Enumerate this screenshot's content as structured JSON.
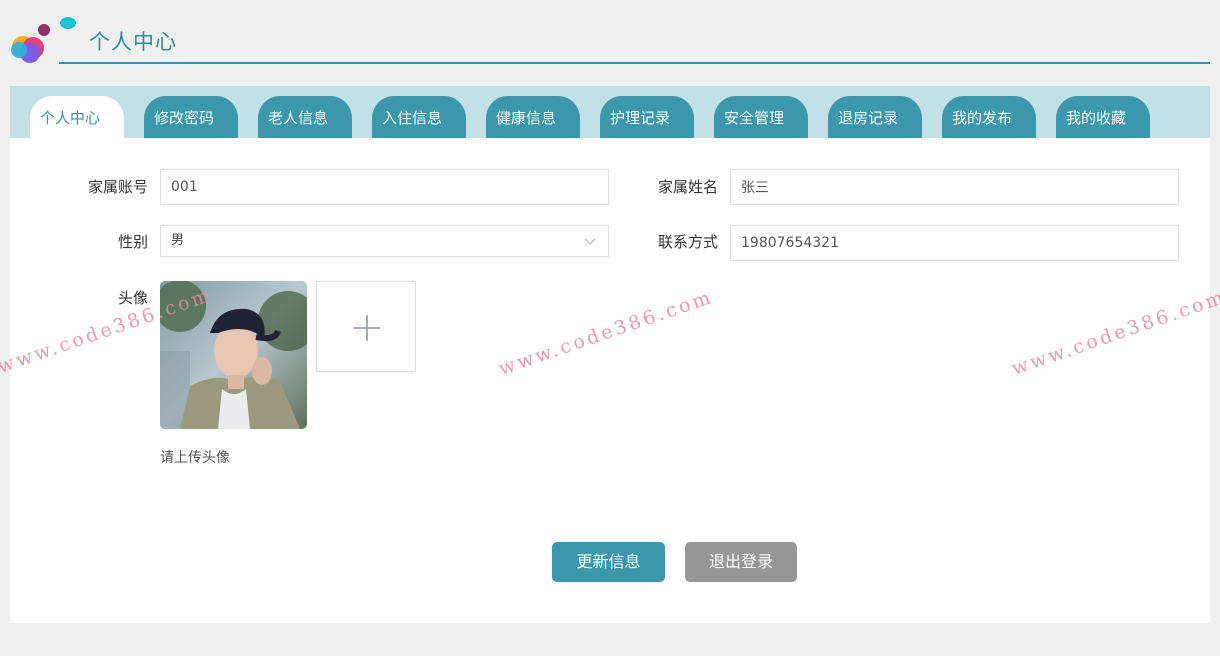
{
  "header": {
    "title": "个人中心"
  },
  "tabs": [
    {
      "label": "个人中心",
      "active": true
    },
    {
      "label": "修改密码",
      "active": false
    },
    {
      "label": "老人信息",
      "active": false
    },
    {
      "label": "入住信息",
      "active": false
    },
    {
      "label": "健康信息",
      "active": false
    },
    {
      "label": "护理记录",
      "active": false
    },
    {
      "label": "安全管理",
      "active": false
    },
    {
      "label": "退房记录",
      "active": false
    },
    {
      "label": "我的发布",
      "active": false
    },
    {
      "label": "我的收藏",
      "active": false
    }
  ],
  "form": {
    "account_label": "家属账号",
    "account_value": "001",
    "name_label": "家属姓名",
    "name_value": "张三",
    "gender_label": "性别",
    "gender_value": "男",
    "phone_label": "联系方式",
    "phone_value": "19807654321",
    "avatar_label": "头像",
    "avatar_hint": "请上传头像"
  },
  "buttons": {
    "update": "更新信息",
    "logout": "退出登录"
  },
  "watermark": "www.code386.com",
  "colors": {
    "accent": "#3a97ac",
    "tabbar_bg": "#c3e0e6",
    "gray_button": "#969696"
  },
  "icons": {
    "upload": "plus-icon",
    "select": "chevron-down-icon"
  }
}
